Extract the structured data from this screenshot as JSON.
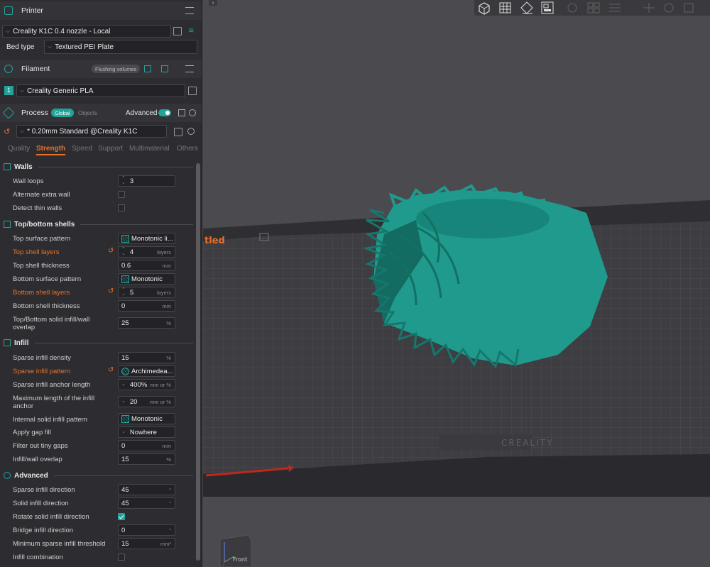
{
  "printer": {
    "title": "Printer",
    "printer_name": "Creality K1C 0.4 nozzle - Local",
    "bed_type_label": "Bed type",
    "bed_type_value": "Textured PEI Plate"
  },
  "filament": {
    "title": "Filament",
    "flushing_label": "Flushing volumes",
    "slot_number": "1",
    "name": "Creality Generic PLA"
  },
  "process": {
    "title": "Process",
    "global_label": "Global",
    "objects_label": "Objects",
    "advanced_label": "Advanced",
    "preset": "* 0.20mm Standard @Creality K1C"
  },
  "tabs": [
    "Quality",
    "Strength",
    "Speed",
    "Support",
    "Multimaterial",
    "Others"
  ],
  "active_tab": "Strength",
  "settings": {
    "walls": {
      "title": "Walls",
      "wall_loops": {
        "label": "Wall loops",
        "value": "3"
      },
      "alternate_extra_wall": {
        "label": "Alternate extra wall",
        "checked": false
      },
      "detect_thin_walls": {
        "label": "Detect thin walls",
        "checked": false
      }
    },
    "shells": {
      "title": "Top/bottom shells",
      "top_surface_pattern": {
        "label": "Top surface pattern",
        "value": "Monotonic li..."
      },
      "top_shell_layers": {
        "label": "Top shell layers",
        "value": "4",
        "unit": "layers"
      },
      "top_shell_thickness": {
        "label": "Top shell thickness",
        "value": "0.6",
        "unit": "mm"
      },
      "bottom_surface_pattern": {
        "label": "Bottom surface pattern",
        "value": "Monotonic"
      },
      "bottom_shell_layers": {
        "label": "Bottom shell layers",
        "value": "5",
        "unit": "layers"
      },
      "bottom_shell_thickness": {
        "label": "Bottom shell thickness",
        "value": "0",
        "unit": "mm"
      },
      "solid_infill_overlap": {
        "label1": "Top/Bottom solid infill/wall",
        "label2": "overlap",
        "value": "25",
        "unit": "%"
      }
    },
    "infill": {
      "title": "Infill",
      "sparse_density": {
        "label": "Sparse infill density",
        "value": "15",
        "unit": "%"
      },
      "sparse_pattern": {
        "label": "Sparse infill pattern",
        "value": "Archimedea..."
      },
      "anchor_length": {
        "label": "Sparse infill anchor length",
        "value": "400%",
        "unit": "mm or %"
      },
      "max_anchor": {
        "label1": "Maximum length of the infill",
        "label2": "anchor",
        "value": "20",
        "unit": "mm or %"
      },
      "internal_solid_pattern": {
        "label": "Internal solid infill pattern",
        "value": "Monotonic"
      },
      "gap_fill": {
        "label": "Apply gap fill",
        "value": "Nowhere"
      },
      "filter_tiny_gaps": {
        "label": "Filter out tiny gaps",
        "value": "0",
        "unit": "mm"
      },
      "infill_wall_overlap": {
        "label": "Infill/wall overlap",
        "value": "15",
        "unit": "%"
      }
    },
    "advanced": {
      "title": "Advanced",
      "sparse_direction": {
        "label": "Sparse infill direction",
        "value": "45",
        "unit": "°"
      },
      "solid_direction": {
        "label": "Solid infill direction",
        "value": "45",
        "unit": "°"
      },
      "rotate_solid": {
        "label": "Rotate solid infill direction",
        "checked": true
      },
      "bridge_direction": {
        "label": "Bridge infill direction",
        "value": "0",
        "unit": "°"
      },
      "min_sparse_threshold": {
        "label": "Minimum sparse infill threshold",
        "value": "15",
        "unit": "mm²"
      },
      "infill_combination": {
        "label": "Infill combination",
        "checked": false
      }
    }
  },
  "viewport": {
    "plate_label": "tled",
    "bed_brand": "CREALITY",
    "view_cube_label": "Front",
    "model_color": "#1f9a8c"
  },
  "colors": {
    "accent": "#21a39a",
    "modified": "#e8702a"
  }
}
